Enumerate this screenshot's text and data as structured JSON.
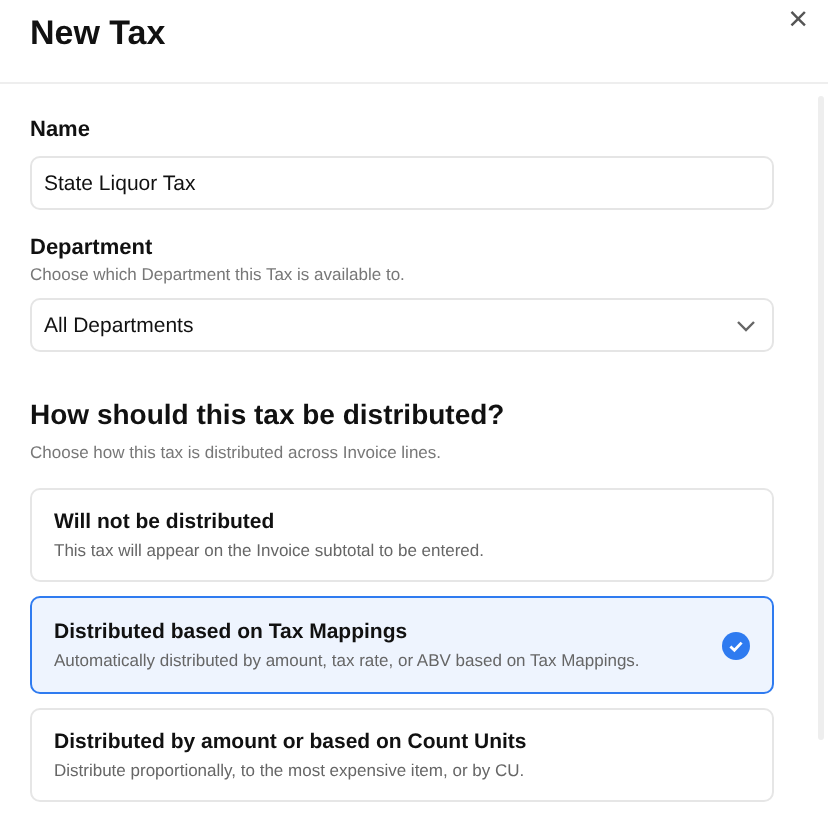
{
  "dialog": {
    "title": "New Tax",
    "close": "×"
  },
  "name_field": {
    "label": "Name",
    "value": "State Liquor Tax"
  },
  "department_field": {
    "label": "Department",
    "help": "Choose which Department this Tax is available to.",
    "value": "All Departments"
  },
  "distribution": {
    "heading": "How should this tax be distributed?",
    "help": "Choose how this tax is distributed across Invoice lines.",
    "options": [
      {
        "title": "Will not be distributed",
        "description": "This tax will appear on the Invoice subtotal to be entered.",
        "selected": false
      },
      {
        "title": "Distributed based on Tax Mappings",
        "description": "Automatically distributed by amount, tax rate, or ABV based on Tax Mappings.",
        "selected": true
      },
      {
        "title": "Distributed by amount or based on Count Units",
        "description": "Distribute proportionally, to the most expensive item, or by CU.",
        "selected": false
      }
    ]
  }
}
